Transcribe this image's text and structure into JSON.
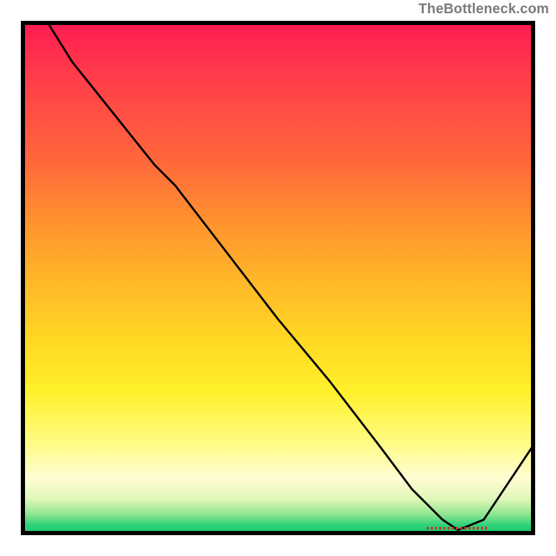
{
  "watermark": "TheBottleneck.com",
  "bottom_marker_label": "",
  "chart_data": {
    "type": "line",
    "title": "",
    "xlabel": "",
    "ylabel": "",
    "xlim": [
      0,
      100
    ],
    "ylim": [
      0,
      100
    ],
    "series": [
      {
        "name": "curve",
        "x": [
          5,
          10,
          18,
          26,
          30,
          40,
          50,
          60,
          70,
          76,
          82,
          85,
          90,
          100
        ],
        "y": [
          100,
          92,
          82,
          72,
          68,
          55,
          42,
          30,
          17,
          9,
          3,
          1,
          3,
          18
        ]
      }
    ],
    "annotations": [
      {
        "type": "minimum-marker",
        "x": 85,
        "label": ""
      }
    ],
    "background": {
      "type": "vertical-gradient",
      "stops": [
        {
          "pos": 0,
          "color": "#ff1a52"
        },
        {
          "pos": 40,
          "color": "#ff962e"
        },
        {
          "pos": 72,
          "color": "#fff02a"
        },
        {
          "pos": 93,
          "color": "#dff7b8"
        },
        {
          "pos": 100,
          "color": "#12c565"
        }
      ]
    }
  }
}
